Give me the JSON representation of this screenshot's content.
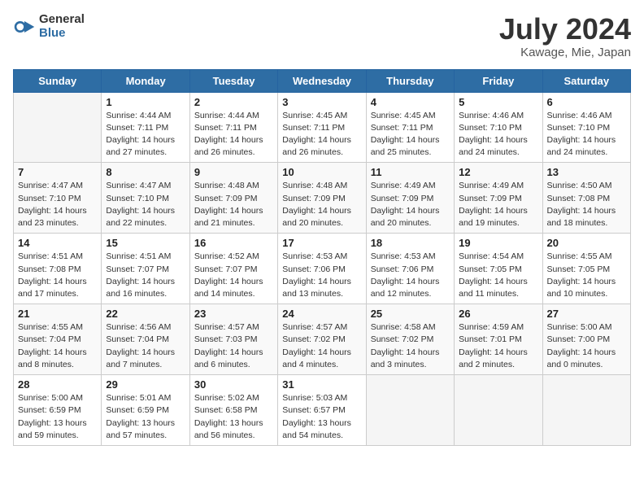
{
  "logo": {
    "general": "General",
    "blue": "Blue"
  },
  "title": {
    "month_year": "July 2024",
    "location": "Kawage, Mie, Japan"
  },
  "weekdays": [
    "Sunday",
    "Monday",
    "Tuesday",
    "Wednesday",
    "Thursday",
    "Friday",
    "Saturday"
  ],
  "weeks": [
    [
      {
        "day": "",
        "info": ""
      },
      {
        "day": "1",
        "info": "Sunrise: 4:44 AM\nSunset: 7:11 PM\nDaylight: 14 hours\nand 27 minutes."
      },
      {
        "day": "2",
        "info": "Sunrise: 4:44 AM\nSunset: 7:11 PM\nDaylight: 14 hours\nand 26 minutes."
      },
      {
        "day": "3",
        "info": "Sunrise: 4:45 AM\nSunset: 7:11 PM\nDaylight: 14 hours\nand 26 minutes."
      },
      {
        "day": "4",
        "info": "Sunrise: 4:45 AM\nSunset: 7:11 PM\nDaylight: 14 hours\nand 25 minutes."
      },
      {
        "day": "5",
        "info": "Sunrise: 4:46 AM\nSunset: 7:10 PM\nDaylight: 14 hours\nand 24 minutes."
      },
      {
        "day": "6",
        "info": "Sunrise: 4:46 AM\nSunset: 7:10 PM\nDaylight: 14 hours\nand 24 minutes."
      }
    ],
    [
      {
        "day": "7",
        "info": "Sunrise: 4:47 AM\nSunset: 7:10 PM\nDaylight: 14 hours\nand 23 minutes."
      },
      {
        "day": "8",
        "info": "Sunrise: 4:47 AM\nSunset: 7:10 PM\nDaylight: 14 hours\nand 22 minutes."
      },
      {
        "day": "9",
        "info": "Sunrise: 4:48 AM\nSunset: 7:09 PM\nDaylight: 14 hours\nand 21 minutes."
      },
      {
        "day": "10",
        "info": "Sunrise: 4:48 AM\nSunset: 7:09 PM\nDaylight: 14 hours\nand 20 minutes."
      },
      {
        "day": "11",
        "info": "Sunrise: 4:49 AM\nSunset: 7:09 PM\nDaylight: 14 hours\nand 20 minutes."
      },
      {
        "day": "12",
        "info": "Sunrise: 4:49 AM\nSunset: 7:09 PM\nDaylight: 14 hours\nand 19 minutes."
      },
      {
        "day": "13",
        "info": "Sunrise: 4:50 AM\nSunset: 7:08 PM\nDaylight: 14 hours\nand 18 minutes."
      }
    ],
    [
      {
        "day": "14",
        "info": "Sunrise: 4:51 AM\nSunset: 7:08 PM\nDaylight: 14 hours\nand 17 minutes."
      },
      {
        "day": "15",
        "info": "Sunrise: 4:51 AM\nSunset: 7:07 PM\nDaylight: 14 hours\nand 16 minutes."
      },
      {
        "day": "16",
        "info": "Sunrise: 4:52 AM\nSunset: 7:07 PM\nDaylight: 14 hours\nand 14 minutes."
      },
      {
        "day": "17",
        "info": "Sunrise: 4:53 AM\nSunset: 7:06 PM\nDaylight: 14 hours\nand 13 minutes."
      },
      {
        "day": "18",
        "info": "Sunrise: 4:53 AM\nSunset: 7:06 PM\nDaylight: 14 hours\nand 12 minutes."
      },
      {
        "day": "19",
        "info": "Sunrise: 4:54 AM\nSunset: 7:05 PM\nDaylight: 14 hours\nand 11 minutes."
      },
      {
        "day": "20",
        "info": "Sunrise: 4:55 AM\nSunset: 7:05 PM\nDaylight: 14 hours\nand 10 minutes."
      }
    ],
    [
      {
        "day": "21",
        "info": "Sunrise: 4:55 AM\nSunset: 7:04 PM\nDaylight: 14 hours\nand 8 minutes."
      },
      {
        "day": "22",
        "info": "Sunrise: 4:56 AM\nSunset: 7:04 PM\nDaylight: 14 hours\nand 7 minutes."
      },
      {
        "day": "23",
        "info": "Sunrise: 4:57 AM\nSunset: 7:03 PM\nDaylight: 14 hours\nand 6 minutes."
      },
      {
        "day": "24",
        "info": "Sunrise: 4:57 AM\nSunset: 7:02 PM\nDaylight: 14 hours\nand 4 minutes."
      },
      {
        "day": "25",
        "info": "Sunrise: 4:58 AM\nSunset: 7:02 PM\nDaylight: 14 hours\nand 3 minutes."
      },
      {
        "day": "26",
        "info": "Sunrise: 4:59 AM\nSunset: 7:01 PM\nDaylight: 14 hours\nand 2 minutes."
      },
      {
        "day": "27",
        "info": "Sunrise: 5:00 AM\nSunset: 7:00 PM\nDaylight: 14 hours\nand 0 minutes."
      }
    ],
    [
      {
        "day": "28",
        "info": "Sunrise: 5:00 AM\nSunset: 6:59 PM\nDaylight: 13 hours\nand 59 minutes."
      },
      {
        "day": "29",
        "info": "Sunrise: 5:01 AM\nSunset: 6:59 PM\nDaylight: 13 hours\nand 57 minutes."
      },
      {
        "day": "30",
        "info": "Sunrise: 5:02 AM\nSunset: 6:58 PM\nDaylight: 13 hours\nand 56 minutes."
      },
      {
        "day": "31",
        "info": "Sunrise: 5:03 AM\nSunset: 6:57 PM\nDaylight: 13 hours\nand 54 minutes."
      },
      {
        "day": "",
        "info": ""
      },
      {
        "day": "",
        "info": ""
      },
      {
        "day": "",
        "info": ""
      }
    ]
  ]
}
